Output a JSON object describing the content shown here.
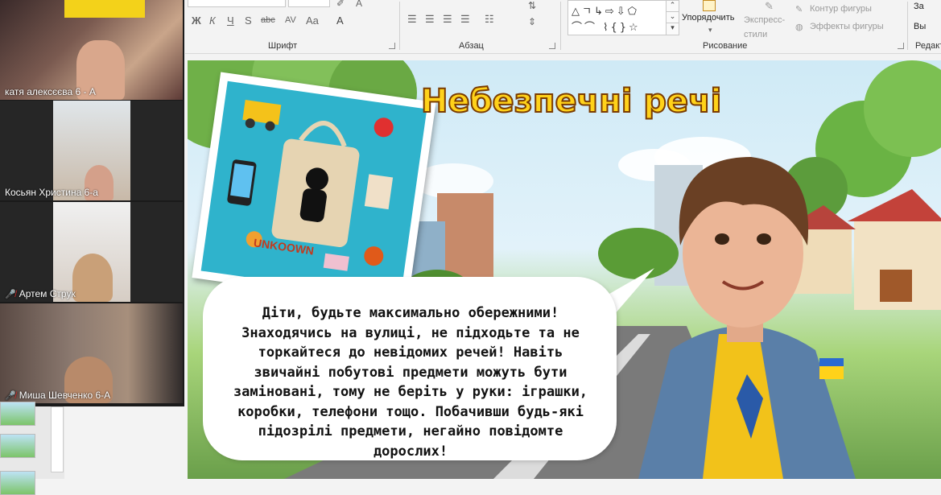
{
  "ribbon": {
    "groups": {
      "font": "Шрифт",
      "paragraph": "Абзац",
      "drawing": "Рисование",
      "editing": "Редакт"
    },
    "font_buttons": [
      "Ж",
      "К",
      "Ч",
      "S",
      "abc",
      "AV",
      "Aa",
      "A"
    ],
    "arrange_label": "Упорядочить",
    "quick_styles_label": "Экспресс-\nстили",
    "shape_outline_label": "Контур фигуры",
    "shape_effects_label": "Эффекты фигуры",
    "editing_find": "За",
    "editing_select": "Вы"
  },
  "participants": [
    {
      "name": "катя алексєєва 6 - А",
      "muted": false
    },
    {
      "name": "Косьян Христина 6-а",
      "muted": false
    },
    {
      "name": "Артем Струк",
      "muted": true
    },
    {
      "name": "Миша Шевченко 6-А",
      "muted": true
    }
  ],
  "slide": {
    "title": "Небезпечні речі",
    "bag_label": "UNKOOWN",
    "bubble_text": "Діти, будьте максимально обережними! Знаходячись на вулиці, не підходьте та не торкайтеся до невідомих речей! Навіть звичайні побутові предмети можуть бути заміновані, тому не беріть у руки: іграшки, коробки, телефони тощо. Побачивши будь-які підозрілі предмети, негайно повідомте дорослих!"
  },
  "colors": {
    "title_fill": "#ffd21a",
    "title_stroke": "#7a3b00",
    "photo_bg": "#2fb3cc",
    "jacket": "#5a7fa8",
    "shirt": "#f2c21a"
  }
}
